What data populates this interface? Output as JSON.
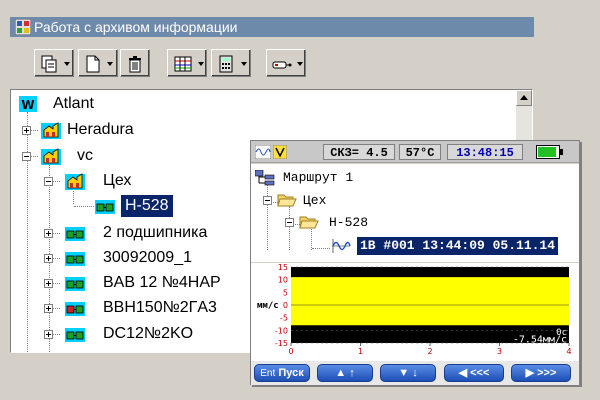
{
  "window": {
    "title": "Работа с архивом информации"
  },
  "tree": {
    "root": {
      "label": "Atlant",
      "icon": "w-logo-icon"
    },
    "nodes": [
      {
        "label": "Heradura",
        "icon": "factory-icon"
      },
      {
        "label": "vc",
        "icon": "factory-icon"
      },
      {
        "label": "Цех",
        "icon": "factory-icon"
      },
      {
        "label": "H-528",
        "icon": "machine-icon"
      },
      {
        "label": "2 подшипника",
        "icon": "machine-icon"
      },
      {
        "label": "30092009_1",
        "icon": "machine-icon"
      },
      {
        "label": "BAB 12 №4HAP",
        "icon": "machine-icon"
      },
      {
        "label": "BBH150№2ГA3",
        "icon": "machine-icon"
      },
      {
        "label": "DC12№2KO",
        "icon": "machine-icon"
      }
    ]
  },
  "device": {
    "status": {
      "rms": "СКЗ= 4.5",
      "temp": "57°C",
      "time": "13:48:15"
    },
    "tree": {
      "route": "Маршрут 1",
      "shop": "Цех",
      "machine": "H-528",
      "measurement": "1B #001 13:44:09 05.11.14"
    },
    "plot": {
      "unit": "мм/с",
      "zero_label": "0c",
      "value_label": "-7.54мм/с",
      "y_ticks": [
        "15",
        "10",
        "5",
        "0",
        "-5",
        "-10",
        "-15"
      ],
      "x_ticks": [
        "0",
        "1",
        "2",
        "3",
        "4"
      ]
    },
    "buttons": {
      "ent": "Ent",
      "start": "Пуск",
      "up": "↑",
      "down": "↓",
      "left": "<<<",
      "right": ">>>"
    }
  },
  "chart_data": {
    "type": "area",
    "ylabel": "мм/с",
    "ylim": [
      -15,
      15
    ],
    "xlim": [
      0,
      4
    ],
    "x_ticks": [
      0,
      1,
      2,
      3,
      4
    ],
    "y_ticks": [
      15,
      10,
      5,
      0,
      -5,
      -10,
      -15
    ],
    "series": [
      {
        "x": [
          0,
          1,
          2,
          3,
          4
        ],
        "upper": [
          11,
          11,
          11,
          11,
          11
        ],
        "lower": [
          -8,
          -8,
          -8,
          -8,
          -8
        ]
      }
    ],
    "colors": {
      "band": "#ffff00",
      "trace": "#000000"
    }
  }
}
